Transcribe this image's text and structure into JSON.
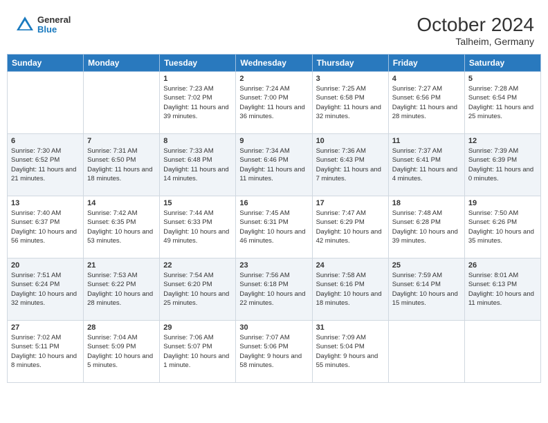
{
  "header": {
    "logo": {
      "general": "General",
      "blue": "Blue"
    },
    "title": "October 2024",
    "location": "Talheim, Germany"
  },
  "weekdays": [
    "Sunday",
    "Monday",
    "Tuesday",
    "Wednesday",
    "Thursday",
    "Friday",
    "Saturday"
  ],
  "weeks": [
    [
      {
        "day": "",
        "sunrise": "",
        "sunset": "",
        "daylight": ""
      },
      {
        "day": "",
        "sunrise": "",
        "sunset": "",
        "daylight": ""
      },
      {
        "day": "1",
        "sunrise": "Sunrise: 7:23 AM",
        "sunset": "Sunset: 7:02 PM",
        "daylight": "Daylight: 11 hours and 39 minutes."
      },
      {
        "day": "2",
        "sunrise": "Sunrise: 7:24 AM",
        "sunset": "Sunset: 7:00 PM",
        "daylight": "Daylight: 11 hours and 36 minutes."
      },
      {
        "day": "3",
        "sunrise": "Sunrise: 7:25 AM",
        "sunset": "Sunset: 6:58 PM",
        "daylight": "Daylight: 11 hours and 32 minutes."
      },
      {
        "day": "4",
        "sunrise": "Sunrise: 7:27 AM",
        "sunset": "Sunset: 6:56 PM",
        "daylight": "Daylight: 11 hours and 28 minutes."
      },
      {
        "day": "5",
        "sunrise": "Sunrise: 7:28 AM",
        "sunset": "Sunset: 6:54 PM",
        "daylight": "Daylight: 11 hours and 25 minutes."
      }
    ],
    [
      {
        "day": "6",
        "sunrise": "Sunrise: 7:30 AM",
        "sunset": "Sunset: 6:52 PM",
        "daylight": "Daylight: 11 hours and 21 minutes."
      },
      {
        "day": "7",
        "sunrise": "Sunrise: 7:31 AM",
        "sunset": "Sunset: 6:50 PM",
        "daylight": "Daylight: 11 hours and 18 minutes."
      },
      {
        "day": "8",
        "sunrise": "Sunrise: 7:33 AM",
        "sunset": "Sunset: 6:48 PM",
        "daylight": "Daylight: 11 hours and 14 minutes."
      },
      {
        "day": "9",
        "sunrise": "Sunrise: 7:34 AM",
        "sunset": "Sunset: 6:46 PM",
        "daylight": "Daylight: 11 hours and 11 minutes."
      },
      {
        "day": "10",
        "sunrise": "Sunrise: 7:36 AM",
        "sunset": "Sunset: 6:43 PM",
        "daylight": "Daylight: 11 hours and 7 minutes."
      },
      {
        "day": "11",
        "sunrise": "Sunrise: 7:37 AM",
        "sunset": "Sunset: 6:41 PM",
        "daylight": "Daylight: 11 hours and 4 minutes."
      },
      {
        "day": "12",
        "sunrise": "Sunrise: 7:39 AM",
        "sunset": "Sunset: 6:39 PM",
        "daylight": "Daylight: 11 hours and 0 minutes."
      }
    ],
    [
      {
        "day": "13",
        "sunrise": "Sunrise: 7:40 AM",
        "sunset": "Sunset: 6:37 PM",
        "daylight": "Daylight: 10 hours and 56 minutes."
      },
      {
        "day": "14",
        "sunrise": "Sunrise: 7:42 AM",
        "sunset": "Sunset: 6:35 PM",
        "daylight": "Daylight: 10 hours and 53 minutes."
      },
      {
        "day": "15",
        "sunrise": "Sunrise: 7:44 AM",
        "sunset": "Sunset: 6:33 PM",
        "daylight": "Daylight: 10 hours and 49 minutes."
      },
      {
        "day": "16",
        "sunrise": "Sunrise: 7:45 AM",
        "sunset": "Sunset: 6:31 PM",
        "daylight": "Daylight: 10 hours and 46 minutes."
      },
      {
        "day": "17",
        "sunrise": "Sunrise: 7:47 AM",
        "sunset": "Sunset: 6:29 PM",
        "daylight": "Daylight: 10 hours and 42 minutes."
      },
      {
        "day": "18",
        "sunrise": "Sunrise: 7:48 AM",
        "sunset": "Sunset: 6:28 PM",
        "daylight": "Daylight: 10 hours and 39 minutes."
      },
      {
        "day": "19",
        "sunrise": "Sunrise: 7:50 AM",
        "sunset": "Sunset: 6:26 PM",
        "daylight": "Daylight: 10 hours and 35 minutes."
      }
    ],
    [
      {
        "day": "20",
        "sunrise": "Sunrise: 7:51 AM",
        "sunset": "Sunset: 6:24 PM",
        "daylight": "Daylight: 10 hours and 32 minutes."
      },
      {
        "day": "21",
        "sunrise": "Sunrise: 7:53 AM",
        "sunset": "Sunset: 6:22 PM",
        "daylight": "Daylight: 10 hours and 28 minutes."
      },
      {
        "day": "22",
        "sunrise": "Sunrise: 7:54 AM",
        "sunset": "Sunset: 6:20 PM",
        "daylight": "Daylight: 10 hours and 25 minutes."
      },
      {
        "day": "23",
        "sunrise": "Sunrise: 7:56 AM",
        "sunset": "Sunset: 6:18 PM",
        "daylight": "Daylight: 10 hours and 22 minutes."
      },
      {
        "day": "24",
        "sunrise": "Sunrise: 7:58 AM",
        "sunset": "Sunset: 6:16 PM",
        "daylight": "Daylight: 10 hours and 18 minutes."
      },
      {
        "day": "25",
        "sunrise": "Sunrise: 7:59 AM",
        "sunset": "Sunset: 6:14 PM",
        "daylight": "Daylight: 10 hours and 15 minutes."
      },
      {
        "day": "26",
        "sunrise": "Sunrise: 8:01 AM",
        "sunset": "Sunset: 6:13 PM",
        "daylight": "Daylight: 10 hours and 11 minutes."
      }
    ],
    [
      {
        "day": "27",
        "sunrise": "Sunrise: 7:02 AM",
        "sunset": "Sunset: 5:11 PM",
        "daylight": "Daylight: 10 hours and 8 minutes."
      },
      {
        "day": "28",
        "sunrise": "Sunrise: 7:04 AM",
        "sunset": "Sunset: 5:09 PM",
        "daylight": "Daylight: 10 hours and 5 minutes."
      },
      {
        "day": "29",
        "sunrise": "Sunrise: 7:06 AM",
        "sunset": "Sunset: 5:07 PM",
        "daylight": "Daylight: 10 hours and 1 minute."
      },
      {
        "day": "30",
        "sunrise": "Sunrise: 7:07 AM",
        "sunset": "Sunset: 5:06 PM",
        "daylight": "Daylight: 9 hours and 58 minutes."
      },
      {
        "day": "31",
        "sunrise": "Sunrise: 7:09 AM",
        "sunset": "Sunset: 5:04 PM",
        "daylight": "Daylight: 9 hours and 55 minutes."
      },
      {
        "day": "",
        "sunrise": "",
        "sunset": "",
        "daylight": ""
      },
      {
        "day": "",
        "sunrise": "",
        "sunset": "",
        "daylight": ""
      }
    ]
  ]
}
